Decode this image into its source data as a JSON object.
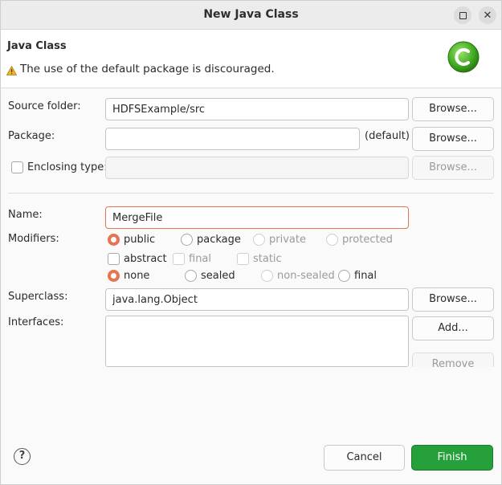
{
  "window": {
    "title": "New Java Class"
  },
  "header": {
    "title": "Java Class",
    "warning": "The use of the default package is discouraged.",
    "logo_icon": "java-class-logo-icon"
  },
  "form": {
    "source_folder": {
      "label": "Source folder:",
      "value": "HDFSExample/src",
      "browse": "Browse..."
    },
    "package": {
      "label": "Package:",
      "value": "",
      "default_text": "(default)",
      "browse": "Browse..."
    },
    "enclosing_type": {
      "label": "Enclosing type:",
      "value": "",
      "checked": false,
      "browse": "Browse..."
    },
    "name": {
      "label": "Name:",
      "value": "MergeFile"
    },
    "modifiers": {
      "label": "Modifiers:",
      "access": [
        "public",
        "package",
        "private",
        "protected"
      ],
      "access_selected": "public",
      "flags": [
        "abstract",
        "final",
        "static"
      ],
      "sealing": [
        "none",
        "sealed",
        "non-sealed",
        "final"
      ],
      "sealing_selected": "none"
    },
    "superclass": {
      "label": "Superclass:",
      "value": "java.lang.Object",
      "browse": "Browse..."
    },
    "interfaces": {
      "label": "Interfaces:",
      "add": "Add...",
      "remove": "Remove"
    }
  },
  "footer": {
    "help": "?",
    "cancel": "Cancel",
    "finish": "Finish"
  },
  "colors": {
    "accent": "#e8734f",
    "finish_green": "#26a03a"
  }
}
